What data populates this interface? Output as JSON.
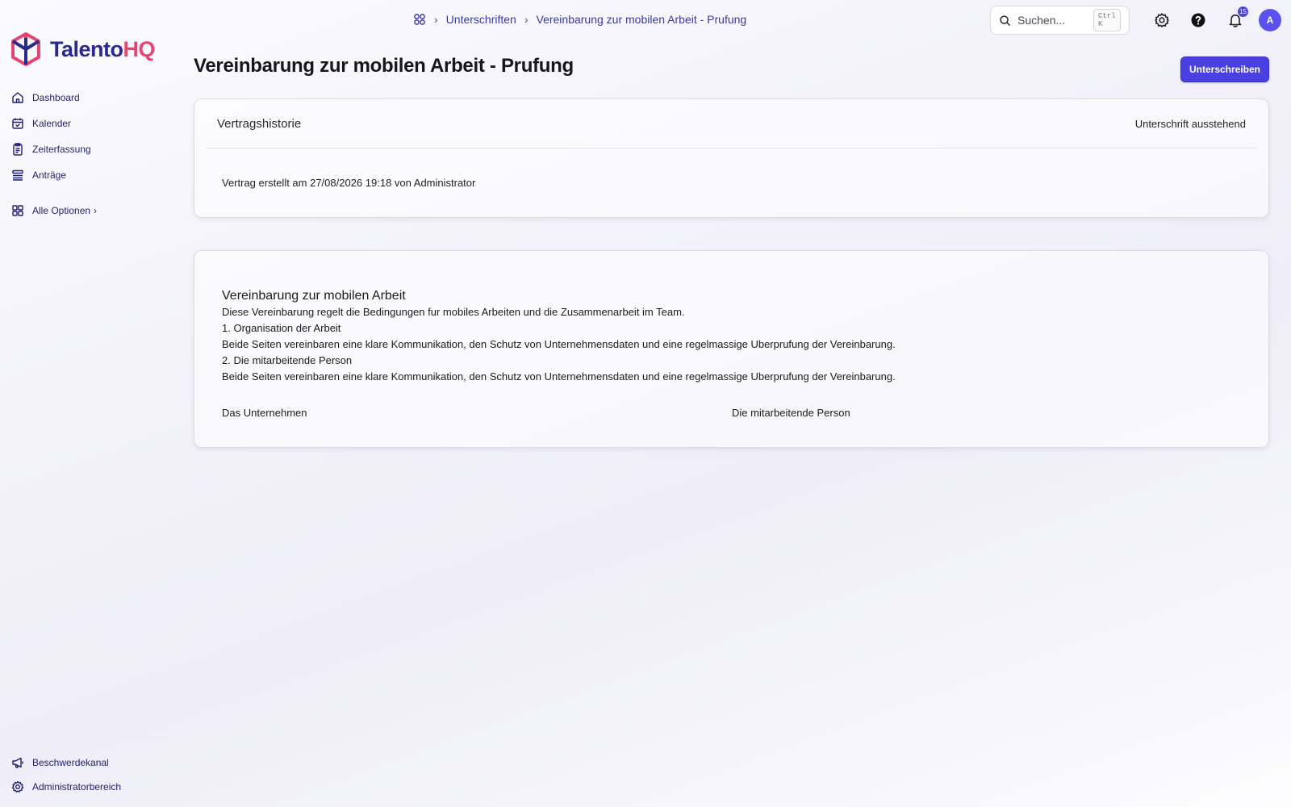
{
  "app": {
    "logo_main": "Talento",
    "logo_accent": "HQ",
    "brand_color": "#2a2a8c",
    "accent_color": "#e6456f",
    "primary_color": "#4a3fe0"
  },
  "sidebar": {
    "items": [
      {
        "label": "Dashboard",
        "icon": "home-icon"
      },
      {
        "label": "Kalender",
        "icon": "calendar-icon"
      },
      {
        "label": "Zeiterfassung",
        "icon": "timesheet-icon"
      },
      {
        "label": "Anträge",
        "icon": "list-icon"
      }
    ],
    "all_options": {
      "label": "Alle Optionen",
      "chevron": "›",
      "icon": "grid-icon"
    },
    "bottom_items": [
      {
        "label": "Beschwerdekanal",
        "icon": "megaphone-icon"
      },
      {
        "label": "Administratorbereich",
        "icon": "gear-icon"
      }
    ]
  },
  "topbar": {
    "breadcrumb": {
      "home_icon": "grid-icon",
      "separator": "›",
      "items": [
        "Unterschriften",
        "Vereinbarung zur mobilen Arbeit - Prufung"
      ]
    },
    "search": {
      "placeholder": "Suchen...",
      "shortcut": "Ctrl K"
    },
    "notifications_count": "15",
    "avatar_initial": "A"
  },
  "main": {
    "title": "Vereinbarung zur mobilen Arbeit - Prufung",
    "sign_button": "Unterschreiben",
    "history": {
      "title": "Vertragshistorie",
      "status": "Unterschrift ausstehend",
      "entries": [
        "Vertrag erstellt am 27/08/2026 19:18 von Administrator"
      ]
    },
    "document": {
      "title": "Vereinbarung zur mobilen Arbeit",
      "lines": [
        "Diese Vereinbarung regelt die Bedingungen fur mobiles Arbeiten und die Zusammenarbeit im Team.",
        "1. Organisation der Arbeit",
        "Beide Seiten vereinbaren eine klare Kommunikation, den Schutz von Unternehmensdaten und eine regelmassige Uberprufung der Vereinbarung.",
        "2. Die mitarbeitende Person",
        "Beide Seiten vereinbaren eine klare Kommunikation, den Schutz von Unternehmensdaten und eine regelmassige Uberprufung der Vereinbarung."
      ],
      "signature_company": "Das Unternehmen",
      "signature_employee": "Die mitarbeitende Person"
    }
  }
}
